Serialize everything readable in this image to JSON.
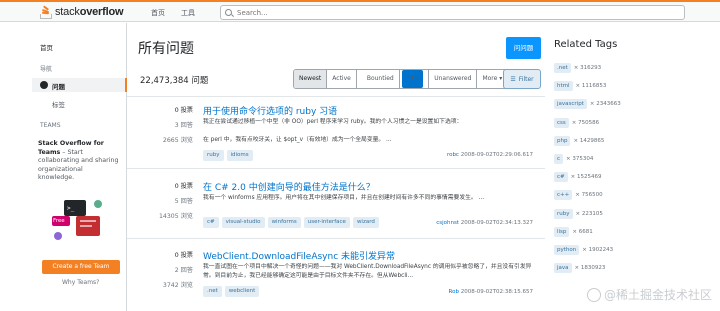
{
  "header": {
    "logo_text_a": "stack",
    "logo_text_b": "overflow",
    "nav": [
      "首页",
      "工具"
    ],
    "search_placeholder": "Search..."
  },
  "sidebar": {
    "home": "首页",
    "public_heading": "导航",
    "questions": "问题",
    "tags": "标签",
    "teams_heading": "TEAMS",
    "teams_title": "Stack Overflow for Teams",
    "teams_text": " – Start collaborating and sharing organizational knowledge.",
    "free_badge": "Free",
    "create_team": "Create a free Team",
    "why_teams": "Why Teams?"
  },
  "main": {
    "title": "所有问题",
    "ask_button": "问问题",
    "count": "22,473,384 问题",
    "filters": [
      {
        "label": "Newest",
        "active": true
      },
      {
        "label": "Active"
      },
      {
        "label": "Bountied",
        "badge": "318"
      },
      {
        "label": "Unanswered"
      },
      {
        "label": "More ▾"
      }
    ],
    "filter_button": "Filter",
    "questions": [
      {
        "votes": "0 投票",
        "answers": "3 回答",
        "views": "2665 浏览",
        "title": "用于使用命令行选项的 ruby 习语",
        "excerpt": "我正在尝试通过移植一个中型（非 OO）perl 程序来学习 ruby。我的个人习惯之一是设置如下选项：\n\n在 perl 中，我有点咬牙关，让 $opt_v（有效地）成为一个全局变量。 ...",
        "tags": [
          "ruby",
          "idioms"
        ],
        "user": "robc",
        "time": "2008-09-02T02:29:06.617"
      },
      {
        "votes": "0 投票",
        "answers": "5 回答",
        "views": "14305 浏览",
        "title": "在 C# 2.0 中创建向导的最佳方法是什么？",
        "excerpt": "我有一个 winforms 应用程序。用户将在其中创建保存项目，并且在创建时间有许多不同的事情需要发生。 ...",
        "tags": [
          "c#",
          "visual-studio",
          "winforms",
          "user-interface",
          "wizard"
        ],
        "user": "csjohnst",
        "time": "2008-09-02T02:34:13.327"
      },
      {
        "votes": "0 投票",
        "answers": "2 回答",
        "views": "3742 浏览",
        "title": "WebClient.DownloadFileAsync 未能引发异常",
        "excerpt": "我一直试图在一个项目中解决一个奇怪的问题——我对 WebClient.DownloadFileAsync 的调用似乎被忽略了，并且没有引发异常。到目前为止，我已经能够确定这可能是由于目标文件夹不存在。但从Webcli...",
        "tags": [
          ".net",
          "webclient"
        ],
        "user": "Rob",
        "time": "2008-09-02T02:38:15.657"
      }
    ]
  },
  "related": {
    "title": "Related Tags",
    "items": [
      {
        "tag": ".net",
        "count": "× 316293"
      },
      {
        "tag": "html",
        "count": "× 1116853"
      },
      {
        "tag": "javascript",
        "count": "× 2343663"
      },
      {
        "tag": "css",
        "count": "× 750586"
      },
      {
        "tag": "php",
        "count": "× 1429865"
      },
      {
        "tag": "c",
        "count": "× 375304"
      },
      {
        "tag": "c#",
        "count": "× 1525469"
      },
      {
        "tag": "c++",
        "count": "× 756500"
      },
      {
        "tag": "ruby",
        "count": "× 223105"
      },
      {
        "tag": "lisp",
        "count": "× 6681"
      },
      {
        "tag": "python",
        "count": "× 1902243"
      },
      {
        "tag": "java",
        "count": "× 1830923"
      }
    ]
  },
  "watermark": "@稀土掘金技术社区",
  "colors": {
    "accent": "#f48024",
    "link": "#0074cc",
    "primary_button": "#0a95ff"
  }
}
